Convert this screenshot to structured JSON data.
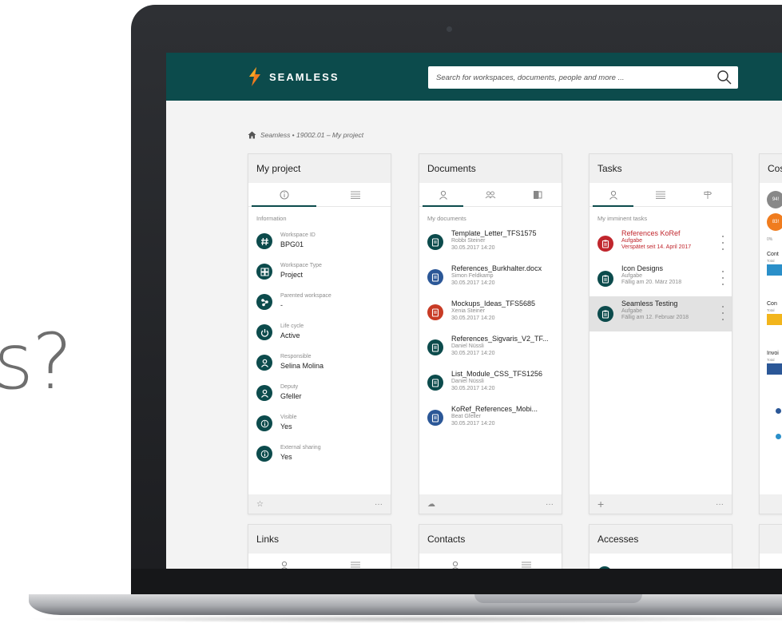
{
  "hero_text": "s?",
  "app": {
    "brand": "SEAMLESS"
  },
  "search": {
    "placeholder": "Search for workspaces, documents, people and more ..."
  },
  "breadcrumb": {
    "text": "Seamless • 19002.01 – My project"
  },
  "project": {
    "title": "My project",
    "section": "Information",
    "items": [
      {
        "label": "Workspace ID",
        "value": "BPG01",
        "icon": "hash-icon"
      },
      {
        "label": "Workspace Type",
        "value": "Project",
        "icon": "grid-icon"
      },
      {
        "label": "Parented workspace",
        "value": "-",
        "icon": "network-icon"
      },
      {
        "label": "Life cycle",
        "value": "Active",
        "icon": "power-icon"
      },
      {
        "label": "Responsible",
        "value": "Selina Molina",
        "icon": "person-icon"
      },
      {
        "label": "Deputy",
        "value": "Gfeller",
        "icon": "person-icon"
      },
      {
        "label": "Visible",
        "value": "Yes",
        "icon": "info-icon"
      },
      {
        "label": "External sharing",
        "value": "Yes",
        "icon": "info-icon"
      }
    ]
  },
  "documents": {
    "title": "Documents",
    "section": "My documents",
    "items": [
      {
        "name": "Template_Letter_TFS1575",
        "author": "Robbi Steiner",
        "date": "30.05.2017 14:20",
        "color": "#0c4b4c"
      },
      {
        "name": "References_Burkhalter.docx",
        "author": "Simon Feldkamp",
        "date": "30.05.2017 14:20",
        "color": "#2b5797"
      },
      {
        "name": "Mockups_Ideas_TFS5685",
        "author": "Xenia Steiner",
        "date": "30.05.2017 14:20",
        "color": "#c83b25"
      },
      {
        "name": "References_Sigvaris_V2_TF...",
        "author": "Daniel Nüssli",
        "date": "30.05.2017 14:20",
        "color": "#0c4b4c"
      },
      {
        "name": "List_Module_CSS_TFS1256",
        "author": "Daniel Nüssli",
        "date": "30.05.2017 14:20",
        "color": "#0c4b4c"
      },
      {
        "name": "KoRef_References_Mobi...",
        "author": "Beat Gfeller",
        "date": "30.05.2017 14:20",
        "color": "#2b5797"
      }
    ]
  },
  "tasks": {
    "title": "Tasks",
    "section": "My imminent tasks",
    "items": [
      {
        "name": "References KoRef",
        "type": "Aufgabe",
        "due": "Verspätet seit 14. April 2017",
        "late": true
      },
      {
        "name": "Icon Designs",
        "type": "Aufgabe",
        "due": "Fällig am 20. März 2018",
        "late": false
      },
      {
        "name": "Seamless Testing",
        "type": "Aufgabe",
        "due": "Fällig am 12. Februar 2018",
        "late": false
      }
    ]
  },
  "costs": {
    "title": "Cos",
    "badges": [
      "94!",
      "83!"
    ],
    "pct": "0%",
    "rows": [
      {
        "label": "Cont",
        "sub": "Total",
        "color": "#2a8fc9"
      },
      {
        "label": "Con",
        "sub": "Total",
        "color": "#f2b51c"
      },
      {
        "label": "Invoi",
        "sub": "Total",
        "color": "#2b5797"
      }
    ]
  },
  "bottom_cards": {
    "links": "Links",
    "contacts": "Contacts",
    "accesses": "Accesses"
  },
  "colors": {
    "primary": "#0c4b4c",
    "late": "#c0262d",
    "word": "#2b5797",
    "powerpoint": "#c83b25"
  }
}
